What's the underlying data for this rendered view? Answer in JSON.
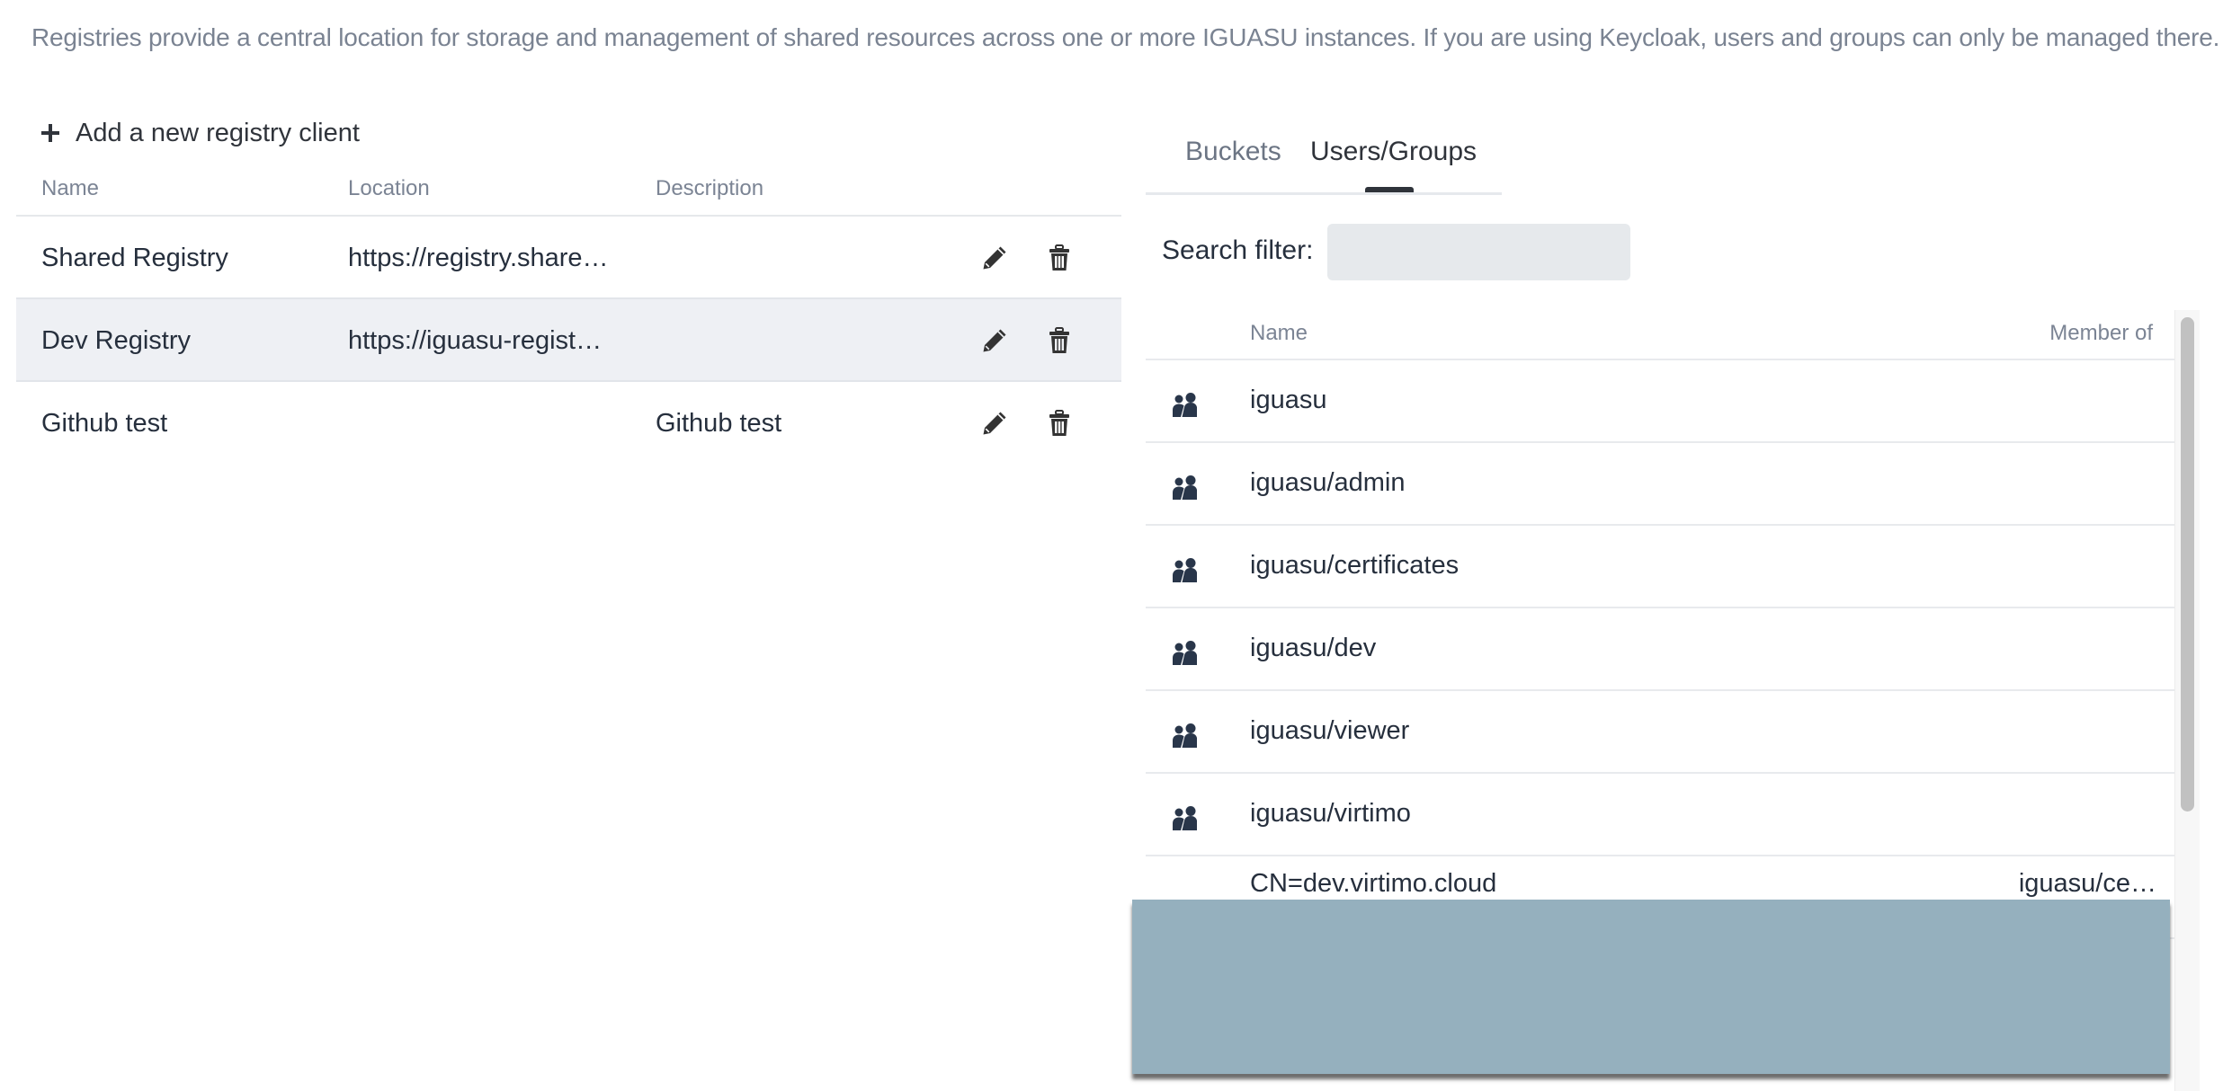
{
  "intro_text": "Registries provide a central location for storage and management of shared resources across one or more IGUASU instances. If you are using Keycloak, users and groups can only be managed there.",
  "add_button": {
    "icon": "plus-icon",
    "label": "Add a new registry client"
  },
  "registry_table": {
    "columns": [
      "Name",
      "Location",
      "Description"
    ],
    "rows": [
      {
        "name": "Shared Registry",
        "location": "https://registry.share…",
        "description": "",
        "highlighted": false
      },
      {
        "name": "Dev Registry",
        "location": "https://iguasu-registr…",
        "description": "",
        "highlighted": true
      },
      {
        "name": "Github test",
        "location": "",
        "description": "Github test",
        "highlighted": false
      }
    ],
    "row_actions": [
      {
        "icon": "pencil-icon",
        "action": "edit"
      },
      {
        "icon": "trash-icon",
        "action": "delete"
      }
    ]
  },
  "tabs": [
    {
      "label": "Buckets",
      "active": false
    },
    {
      "label": "Users/Groups",
      "active": true
    }
  ],
  "search": {
    "label": "Search filter:",
    "value": "",
    "placeholder": ""
  },
  "users_table": {
    "columns": [
      "Name",
      "Member of"
    ],
    "rows": [
      {
        "type": "group",
        "icon": "group-icon",
        "name": "iguasu",
        "member_of": ""
      },
      {
        "type": "group",
        "icon": "group-icon",
        "name": "iguasu/admin",
        "member_of": ""
      },
      {
        "type": "group",
        "icon": "group-icon",
        "name": "iguasu/certificates",
        "member_of": ""
      },
      {
        "type": "group",
        "icon": "group-icon",
        "name": "iguasu/dev",
        "member_of": ""
      },
      {
        "type": "group",
        "icon": "group-icon",
        "name": "iguasu/viewer",
        "member_of": ""
      },
      {
        "type": "group",
        "icon": "group-icon",
        "name": "iguasu/virtimo",
        "member_of": ""
      },
      {
        "type": "user",
        "icon": "",
        "name": "CN=dev.virtimo.cloud",
        "member_of": "iguasu/ce…"
      }
    ]
  },
  "colors": {
    "text_primary": "#262f3d",
    "text_muted": "#7b8494",
    "row_highlight": "#eef0f4",
    "input_bg": "#e6e9ec",
    "overlay": "#95b0be"
  }
}
